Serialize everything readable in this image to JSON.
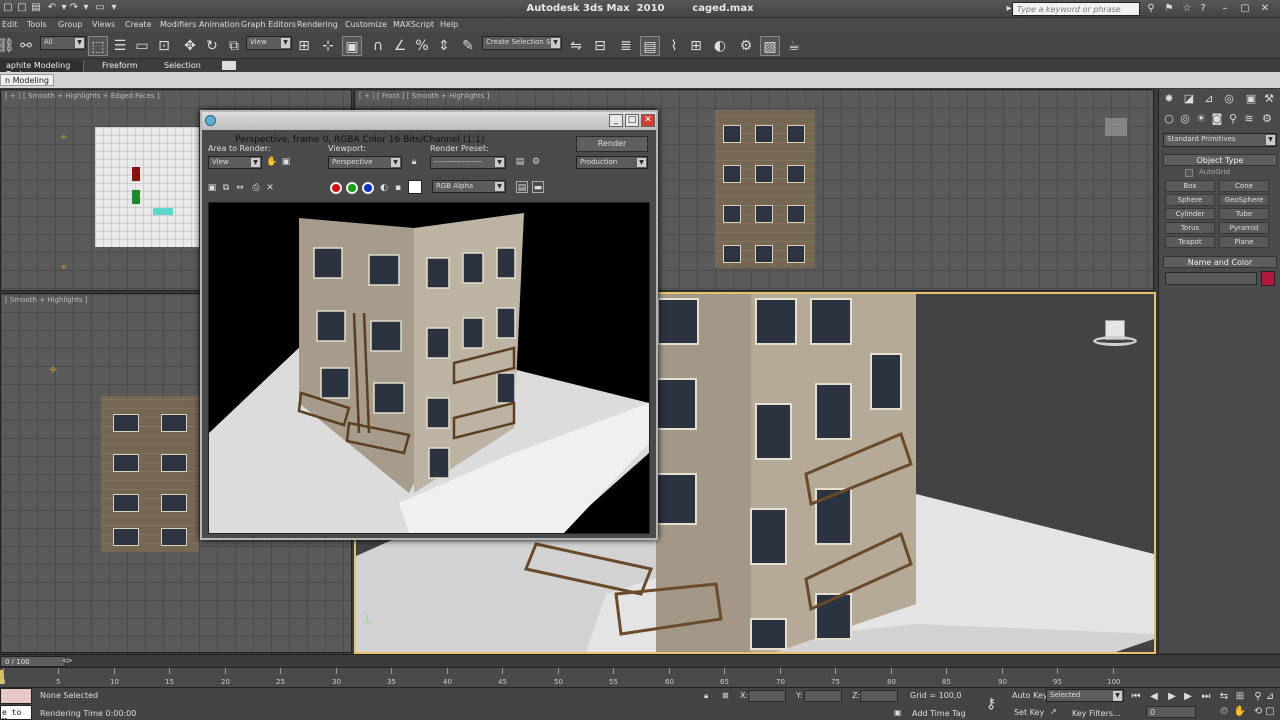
{
  "title_bar": {
    "app_title": "Autodesk 3ds Max  2010        caged.max",
    "search_placeholder": "Type a keyword or phrase"
  },
  "menu": [
    "Edit",
    "Tools",
    "Group",
    "Views",
    "Create",
    "Modifiers",
    "Animation",
    "Graph Editors",
    "Rendering",
    "Customize",
    "MAXScript",
    "Help"
  ],
  "main_toolbar": {
    "selection_filter": "All",
    "ref_coord": "View",
    "named_selection": "Create Selection Se"
  },
  "ribbon": {
    "tabs": [
      "aphite Modeling Tools",
      "Freeform",
      "Selection"
    ],
    "panel_label": "n Modeling"
  },
  "viewports": {
    "top_label": "[ + ] [ Smooth + Highlights + Edged Faces ]",
    "front_label": "[ + ] [ Front ] [ Smooth + Highlights ]",
    "left_label": "[ Smooth + Highlights ]"
  },
  "render_window": {
    "title": "Perspective, frame 0, RGBA Color 16 Bits/Channel (1:1)",
    "area_label": "Area to Render:",
    "area_value": "View",
    "viewport_label": "Viewport:",
    "viewport_value": "Perspective",
    "preset_label": "Render Preset:",
    "preset_value": "-------------------",
    "render_button": "Render",
    "mode_value": "Production",
    "channel_value": "RGB Alpha"
  },
  "command_panel": {
    "category": "Standard Primitives",
    "object_type_header": "Object Type",
    "autogrid_label": "AutoGrid",
    "buttons": [
      "Box",
      "Cone",
      "Sphere",
      "GeoSphere",
      "Cylinder",
      "Tube",
      "Torus",
      "Pyramid",
      "Teapot",
      "Plane"
    ],
    "name_color_header": "Name and Color",
    "swatch_color": "#b0183c"
  },
  "timeline": {
    "frame_display": "0 / 100",
    "ticks": [
      "0",
      "5",
      "10",
      "15",
      "20",
      "25",
      "30",
      "35",
      "40",
      "45",
      "50",
      "55",
      "60",
      "65",
      "70",
      "75",
      "80",
      "85",
      "90",
      "95",
      "100"
    ]
  },
  "status": {
    "selection": "None Selected",
    "render_time": "Rendering Time  0:00:00",
    "maxscript_snippet": "e to M",
    "x_label": "X:",
    "y_label": "Y:",
    "z_label": "Z:",
    "grid": "Grid = 100,0",
    "add_time_tag": "Add Time Tag",
    "auto_key": "Auto Key",
    "selected": "Selected",
    "set_key": "Set Key",
    "key_filters": "Key Filters...",
    "frame_value": "0"
  }
}
